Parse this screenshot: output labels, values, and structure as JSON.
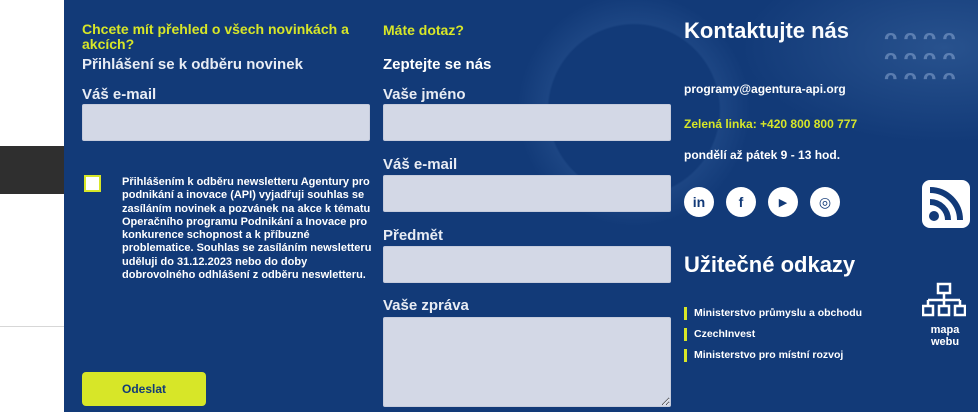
{
  "newsletter": {
    "heading": "Chcete mít přehled o všech novinkách a akcích?",
    "subheading": "Přihlášení se k odběru novinek",
    "email_label": "Váš e-mail",
    "email_value": "",
    "consent_checked": false,
    "consent_text": "Přihlášením k odběru newsletteru Agentury pro podnikání a inovace (API) vyjadřuji souhlas se zasíláním novinek a pozvánek na akce k tématu Operačního programu Podnikání a Inovace pro konkurence schopnost a k příbuzné problematice. Souhlas se zasíláním newsletteru uděluji do 31.12.2023 nebo do doby dobrovolného odhlášení z odběru neswletteru.",
    "submit_label": "Odeslat"
  },
  "question_form": {
    "heading": "Máte dotaz?",
    "subheading": "Zeptejte se nás",
    "name_label": "Vaše jméno",
    "email_label": "Váš e-mail",
    "subject_label": "Předmět",
    "message_label": "Vaše zpráva"
  },
  "contact": {
    "title": "Kontaktujte nás",
    "email": "programy@agentura-api.org",
    "hotline": "Zelená linka: +420 800 800 777",
    "hours": "pondělí až pátek 9 - 13 hod.",
    "social": [
      {
        "icon": "linkedin-icon",
        "glyph": "in"
      },
      {
        "icon": "facebook-icon",
        "glyph": "f"
      },
      {
        "icon": "youtube-icon",
        "glyph": "▶"
      },
      {
        "icon": "instagram-icon",
        "glyph": "◎"
      }
    ]
  },
  "useful_links": {
    "title": "Užitečné odkazy",
    "items": [
      "Ministerstvo průmyslu a obchodu",
      "CzechInvest",
      "Ministerstvo pro místní rozvoj"
    ]
  },
  "side_tools": {
    "rss_icon": "rss-icon",
    "sitemap_icon": "sitemap-icon",
    "sitemap_label": "mapa webu"
  },
  "colors": {
    "background": "#123a78",
    "accent": "#d7e628",
    "field": "#d3d8e6"
  }
}
